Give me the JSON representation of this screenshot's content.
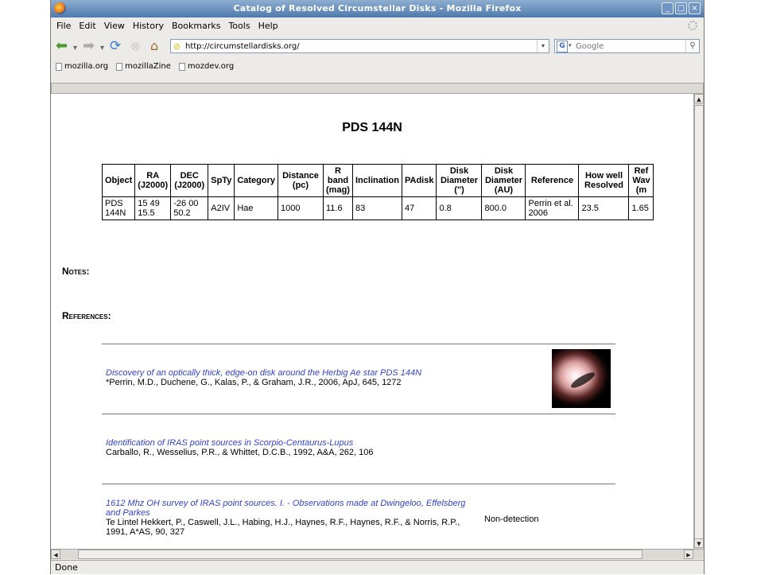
{
  "window": {
    "title": "Catalog of Resolved Circumstellar Disks - Mozilla Firefox"
  },
  "menu": [
    "File",
    "Edit",
    "View",
    "History",
    "Bookmarks",
    "Tools",
    "Help"
  ],
  "nav": {
    "url": "http://circumstellardisks.org/",
    "search_placeholder": "Google"
  },
  "bookmarks": [
    "mozilla.org",
    "mozillaZine",
    "mozdev.org"
  ],
  "page": {
    "heading": "PDS 144N",
    "table": {
      "headers": [
        "Object",
        "RA (J2000)",
        "DEC (J2000)",
        "SpTy",
        "Category",
        "Distance (pc)",
        "R band (mag)",
        "Inclination",
        "PAdisk",
        "Disk Diameter (\")",
        "Disk Diameter (AU)",
        "Reference",
        "How well Resolved",
        "Ref Wav (m"
      ],
      "row": [
        "PDS 144N",
        "15 49 15.5",
        "-26 00 50.2",
        "A2IV",
        "Hae",
        "1000",
        "11.6",
        "83",
        "47",
        "0.8",
        "800.0",
        "Perrin et al. 2006",
        "23.5",
        "1.65"
      ]
    },
    "notes_label": "Notes:",
    "references_label": "References:",
    "references": [
      {
        "title": "Discovery of an optically thick, edge-on disk around the Herbig Ae star PDS 144N",
        "authors": "*Perrin, M.D., Duchene, G., Kalas, P., & Graham, J.R., 2006, ApJ, 645, 1272",
        "note": ""
      },
      {
        "title": "Identification of IRAS point sources in Scorpio-Centaurus-Lupus",
        "authors": "Carballo, R., Wesselius, P.R., & Whittet, D.C.B., 1992, A&A, 262, 106",
        "note": ""
      },
      {
        "title": "1612 Mhz OH survey of IRAS point sources. I. - Observations made at Dwingeloo, Effelsberg and Parkes",
        "authors": "Te Lintel Hekkert, P., Caswell, J.L., Habing, H.J., Haynes, R.F., Haynes, R.F., & Norris, R.P., 1991, A*AS, 90, 327",
        "note": "Non-detection"
      }
    ]
  },
  "status": "Done"
}
